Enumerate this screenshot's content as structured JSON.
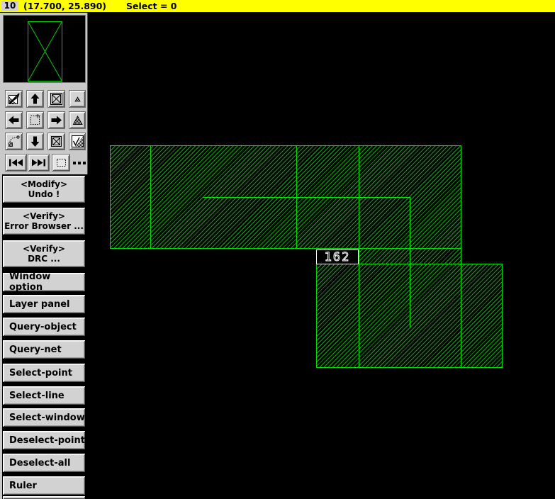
{
  "title_bar": {
    "window_id": "10",
    "coordinates": "(17.700, 25.890)",
    "select_count": "Select = 0"
  },
  "canvas": {
    "shape_label": "162"
  },
  "sidebar": {
    "toolbar_icons": [
      "edit-layer",
      "pan-up",
      "zoom-fit",
      "zoom-out-small",
      "pan-left",
      "zoom-window",
      "pan-right",
      "zoom-in",
      "zoom-previous",
      "pan-down",
      "redraw",
      "mask-edit",
      "view-first",
      "view-last",
      "select-box",
      "more-options"
    ],
    "command_buttons": [
      {
        "line1": "<Modify>",
        "line2": "Undo !"
      },
      {
        "line1": "<Verify>",
        "line2": "Error Browser ..."
      },
      {
        "line1": "<Verify>",
        "line2": "DRC ..."
      },
      {
        "label": "Window option"
      },
      {
        "label": "Layer panel"
      },
      {
        "label": "Query-object"
      },
      {
        "label": "Query-net"
      },
      {
        "label": "Select-point"
      },
      {
        "label": "Select-line"
      },
      {
        "label": "Select-window"
      },
      {
        "label": "Deselect-point"
      },
      {
        "label": "Deselect-all"
      },
      {
        "label": "Ruler"
      }
    ]
  },
  "colors": {
    "titlebar_bg": "#ffff00",
    "canvas_bg": "#000000",
    "shape_border_green": "#00dc00",
    "hatch_green": "#00cd00",
    "wire_green": "#00ee00",
    "button_face": "#d2d2d2",
    "label_outline": "#ffffff"
  }
}
